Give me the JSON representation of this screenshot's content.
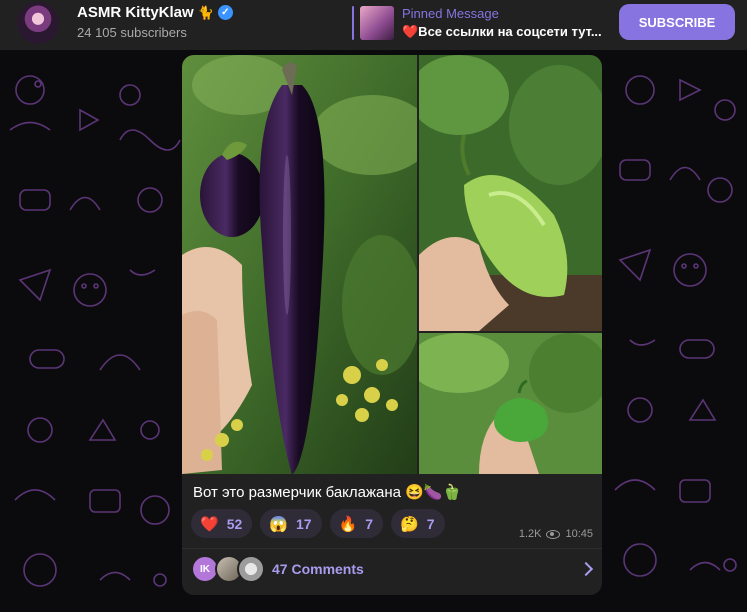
{
  "channel": {
    "title": "ASMR KittyKlaw",
    "title_emoji": "🐈",
    "subscribers": "24 105 subscribers"
  },
  "pinned": {
    "title": "Pinned Message",
    "text": "❤️Все ссылки на соцсети тут..."
  },
  "header": {
    "subscribe_label": "SUBSCRIBE"
  },
  "post": {
    "caption": "Вот это размерчик баклажана 😆🍆🫑",
    "reactions": [
      {
        "emoji": "❤️",
        "count": "52"
      },
      {
        "emoji": "😱",
        "count": "17"
      },
      {
        "emoji": "🔥",
        "count": "7"
      },
      {
        "emoji": "🤔",
        "count": "7"
      }
    ],
    "views": "1.2K",
    "time": "10:45",
    "comments_label": "47 Comments",
    "commenter_initials": "IK"
  },
  "colors": {
    "accent": "#8774e1",
    "header_bg": "#212121",
    "page_bg": "#0b0b0d"
  }
}
